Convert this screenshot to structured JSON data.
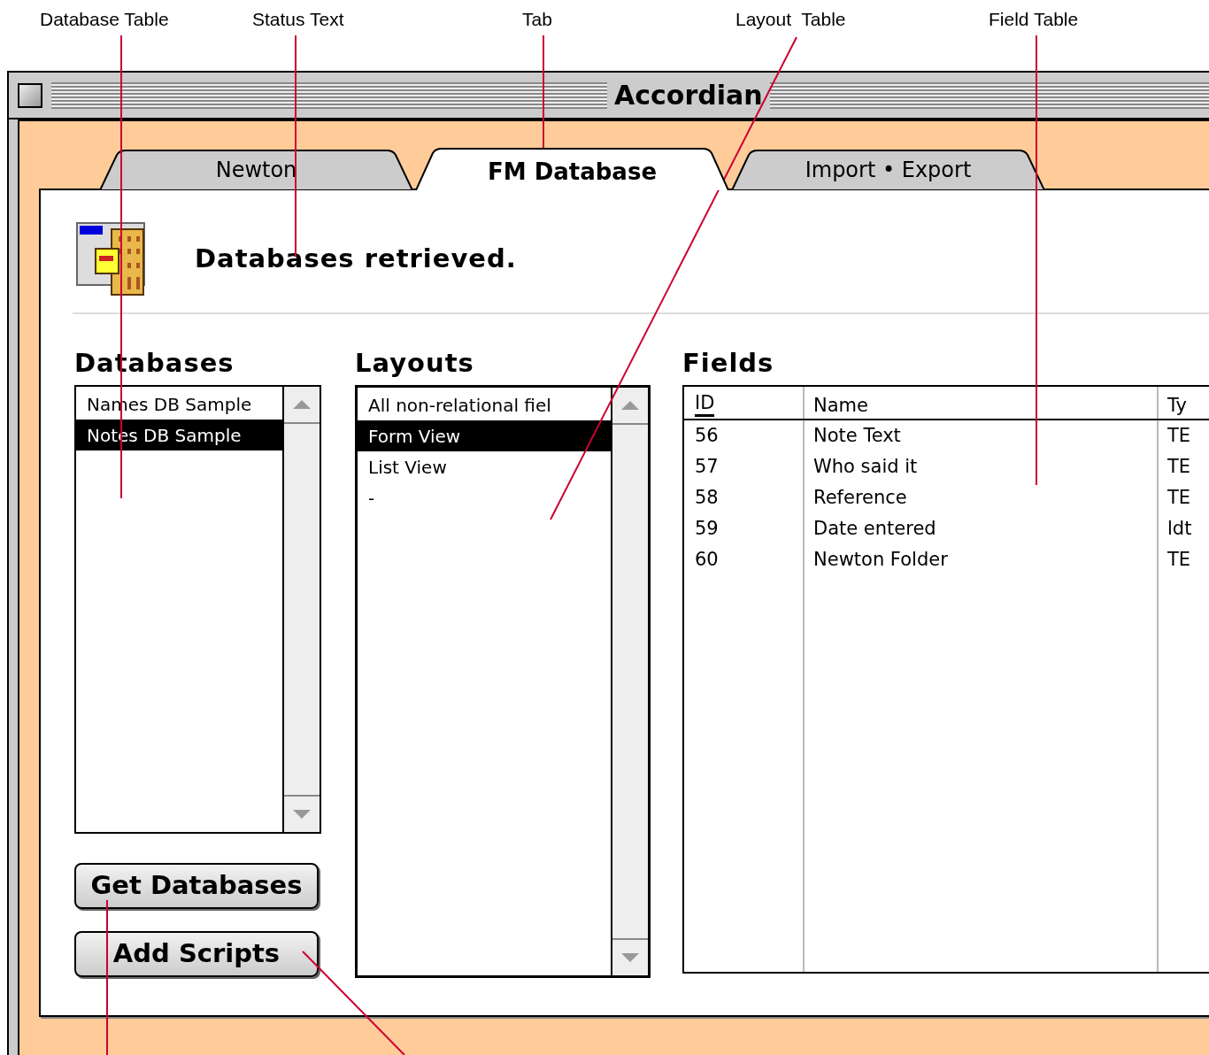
{
  "callouts": [
    "Database Table",
    "Status Text",
    "Tab",
    "Layout  Table",
    "Field Table"
  ],
  "window": {
    "title": "Accordian"
  },
  "tabs": [
    {
      "label": "Newton",
      "selected": false
    },
    {
      "label": "FM Database",
      "selected": true
    },
    {
      "label": "Import • Export",
      "selected": false
    }
  ],
  "status_text": "Databases retrieved.",
  "databases": {
    "heading": "Databases",
    "items": [
      {
        "label": "Names DB Sample",
        "selected": false
      },
      {
        "label": "Notes DB Sample",
        "selected": true
      }
    ]
  },
  "layouts": {
    "heading": "Layouts",
    "items": [
      {
        "label": "All non-relational fiel",
        "selected": false
      },
      {
        "label": "Form View",
        "selected": true
      },
      {
        "label": "List View",
        "selected": false
      },
      {
        "label": "-",
        "selected": false
      }
    ]
  },
  "fields": {
    "heading": "Fields",
    "columns": [
      {
        "label": "ID",
        "sorted": true
      },
      {
        "label": "Name",
        "sorted": false
      },
      {
        "label": "Ty",
        "sorted": false
      }
    ],
    "rows": [
      [
        "56",
        "Note Text",
        "TE"
      ],
      [
        "57",
        "Who said it",
        "TE"
      ],
      [
        "58",
        "Reference",
        "TE"
      ],
      [
        "59",
        "Date entered",
        "ldt"
      ],
      [
        "60",
        "Newton Folder",
        "TE"
      ]
    ]
  },
  "buttons": [
    "Get Databases",
    "Add Scripts"
  ]
}
